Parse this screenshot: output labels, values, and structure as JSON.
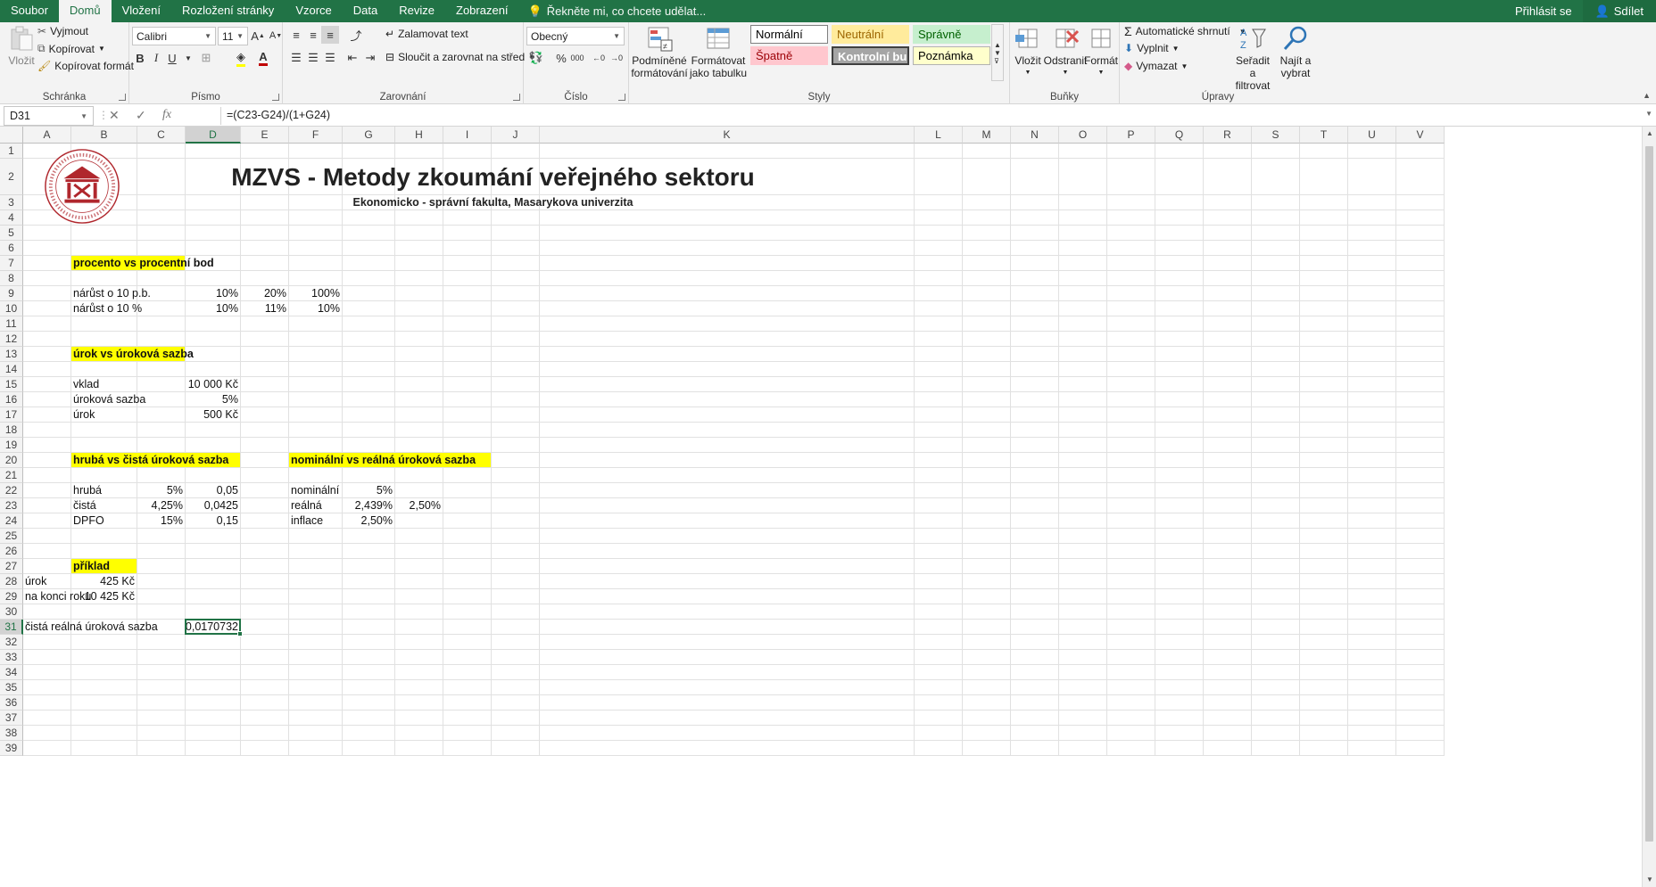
{
  "tabs": [
    "Soubor",
    "Domů",
    "Vložení",
    "Rozložení stránky",
    "Vzorce",
    "Data",
    "Revize",
    "Zobrazení"
  ],
  "active_tab": "Domů",
  "tell_me": "Řekněte mi, co chcete udělat...",
  "signin": "Přihlásit se",
  "share": "Sdílet",
  "ribbon": {
    "clipboard": {
      "label": "Schránka",
      "paste": "Vložit",
      "cut": "Vyjmout",
      "copy": "Kopírovat",
      "format_painter": "Kopírovat formát"
    },
    "font": {
      "label": "Písmo",
      "name": "Calibri",
      "size": "11",
      "bold": "B",
      "italic": "I",
      "underline": "U"
    },
    "alignment": {
      "label": "Zarovnání",
      "wrap": "Zalamovat text",
      "merge": "Sloučit a zarovnat na střed"
    },
    "number": {
      "label": "Číslo",
      "format": "Obecný"
    },
    "styles": {
      "label": "Styly",
      "conditional": [
        "Podmíněné",
        "formátování"
      ],
      "as_table": [
        "Formátovat",
        "jako tabulku"
      ],
      "items": [
        {
          "label": "Normální",
          "bg": "#ffffff",
          "fg": "#000000",
          "border": "#7f7f7f"
        },
        {
          "label": "Neutrální",
          "bg": "#ffeb9c",
          "fg": "#9c6500",
          "border": "#ffeb9c"
        },
        {
          "label": "Správně",
          "bg": "#c6efce",
          "fg": "#006100",
          "border": "#c6efce"
        },
        {
          "label": "Špatně",
          "bg": "#ffc7ce",
          "fg": "#9c0006",
          "border": "#ffc7ce"
        },
        {
          "label": "Kontrolní bu...",
          "bg": "#a5a5a5",
          "fg": "#ffffff",
          "border": "#3f3f3f"
        },
        {
          "label": "Poznámka",
          "bg": "#ffffcc",
          "fg": "#000000",
          "border": "#b2b2b2"
        }
      ]
    },
    "cells": {
      "label": "Buňky",
      "insert": "Vložit",
      "delete": "Odstranit",
      "format": "Formát"
    },
    "editing": {
      "label": "Úpravy",
      "autosum": "Automatické shrnutí",
      "fill": "Vyplnit",
      "clear": "Vymazat",
      "sort": [
        "Seřadit a",
        "filtrovat"
      ],
      "find": [
        "Najít a",
        "vybrat"
      ]
    }
  },
  "name_box": "D31",
  "formula": "=(C23-G24)/(1+G24)",
  "columns": [
    "A",
    "B",
    "C",
    "D",
    "E",
    "F",
    "G",
    "H",
    "I",
    "J",
    "K",
    "L",
    "M",
    "N",
    "O",
    "P",
    "Q",
    "R",
    "S",
    "T",
    "U",
    "V"
  ],
  "selected_column": "D",
  "rows": [
    1,
    2,
    3,
    4,
    5,
    6,
    7,
    8,
    9,
    10,
    11,
    12,
    13,
    14,
    15,
    16,
    17,
    18,
    19,
    20,
    21,
    22,
    23,
    24,
    25,
    26,
    27,
    28,
    29,
    30,
    31,
    32,
    33,
    34,
    35,
    36,
    37,
    38,
    39
  ],
  "selected_row": 31,
  "sheet": {
    "title": "MZVS - Metody zkoumání veřejného sektoru",
    "subtitle": "Ekonomicko - správní fakulta, Masarykova univerzita",
    "logo_text": "UNIVERSITAS MASARYKIANA BRUNENSIS · FACULTAS RERUM OECONOMICARUM",
    "cells": [
      {
        "col": "B",
        "row": 7,
        "text": "procento vs procentní bod",
        "bold": true,
        "fill": "#ffff00",
        "span": 2
      },
      {
        "col": "B",
        "row": 9,
        "text": "nárůst o  10 p.b."
      },
      {
        "col": "D",
        "row": 9,
        "text": "10%",
        "align": "r"
      },
      {
        "col": "E",
        "row": 9,
        "text": "20%",
        "align": "r"
      },
      {
        "col": "F",
        "row": 9,
        "text": "100%",
        "align": "r"
      },
      {
        "col": "B",
        "row": 10,
        "text": "nárůst  o  10 %"
      },
      {
        "col": "D",
        "row": 10,
        "text": "10%",
        "align": "r"
      },
      {
        "col": "E",
        "row": 10,
        "text": "11%",
        "align": "r"
      },
      {
        "col": "F",
        "row": 10,
        "text": "10%",
        "align": "r"
      },
      {
        "col": "B",
        "row": 13,
        "text": "úrok vs úroková sazba",
        "bold": true,
        "fill": "#ffff00",
        "span": 2
      },
      {
        "col": "B",
        "row": 15,
        "text": "vklad"
      },
      {
        "col": "D",
        "row": 15,
        "text": "10 000 Kč",
        "align": "r"
      },
      {
        "col": "B",
        "row": 16,
        "text": "úroková sazba"
      },
      {
        "col": "D",
        "row": 16,
        "text": "5%",
        "align": "r"
      },
      {
        "col": "B",
        "row": 17,
        "text": "úrok"
      },
      {
        "col": "D",
        "row": 17,
        "text": "500 Kč",
        "align": "r"
      },
      {
        "col": "B",
        "row": 20,
        "text": "hrubá vs čistá úroková sazba",
        "bold": true,
        "fill": "#ffff00",
        "span": 3
      },
      {
        "col": "F",
        "row": 20,
        "text": "nominální vs reálná úroková sazba",
        "bold": true,
        "fill": "#ffff00",
        "span": 4
      },
      {
        "col": "B",
        "row": 22,
        "text": "hrubá"
      },
      {
        "col": "C",
        "row": 22,
        "text": "5%",
        "align": "r"
      },
      {
        "col": "D",
        "row": 22,
        "text": "0,05",
        "align": "r"
      },
      {
        "col": "F",
        "row": 22,
        "text": "nominální"
      },
      {
        "col": "G",
        "row": 22,
        "text": "5%",
        "align": "r"
      },
      {
        "col": "B",
        "row": 23,
        "text": "čistá"
      },
      {
        "col": "C",
        "row": 23,
        "text": "4,25%",
        "align": "r"
      },
      {
        "col": "D",
        "row": 23,
        "text": "0,0425",
        "align": "r"
      },
      {
        "col": "F",
        "row": 23,
        "text": "reálná"
      },
      {
        "col": "G",
        "row": 23,
        "text": "2,439%",
        "align": "r"
      },
      {
        "col": "H",
        "row": 23,
        "text": "2,50%",
        "align": "r"
      },
      {
        "col": "B",
        "row": 24,
        "text": "DPFO"
      },
      {
        "col": "C",
        "row": 24,
        "text": "15%",
        "align": "r"
      },
      {
        "col": "D",
        "row": 24,
        "text": "0,15",
        "align": "r"
      },
      {
        "col": "F",
        "row": 24,
        "text": "inflace"
      },
      {
        "col": "G",
        "row": 24,
        "text": "2,50%",
        "align": "r"
      },
      {
        "col": "B",
        "row": 27,
        "text": "příklad",
        "bold": true,
        "fill": "#ffff00"
      },
      {
        "col": "A",
        "row": 28,
        "text": "úrok"
      },
      {
        "col": "B",
        "row": 28,
        "text": "425 Kč",
        "align": "r"
      },
      {
        "col": "A",
        "row": 29,
        "text": "na konci roku"
      },
      {
        "col": "B",
        "row": 29,
        "text": "10 425 Kč",
        "align": "r"
      },
      {
        "col": "A",
        "row": 31,
        "text": "čistá reálná úroková sazba"
      },
      {
        "col": "D",
        "row": 31,
        "text": "0,0170732",
        "align": "r"
      }
    ]
  }
}
